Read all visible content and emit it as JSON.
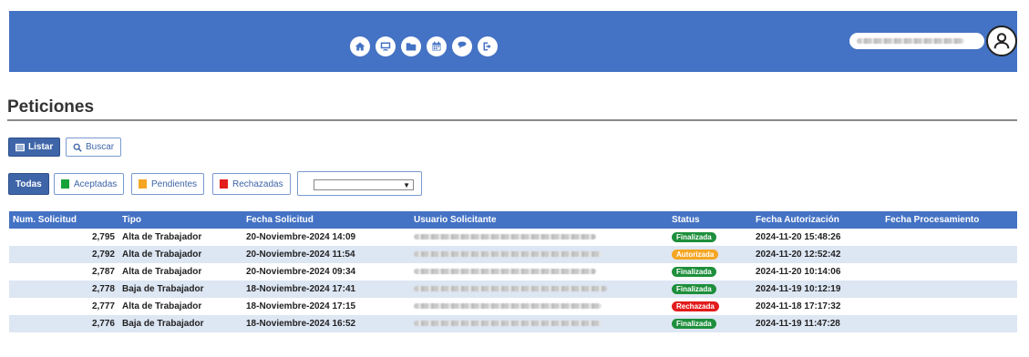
{
  "header": {
    "nav_icons": [
      "home-icon",
      "monitor-icon",
      "folder-icon",
      "calendar-icon",
      "chat-icon",
      "logout-icon"
    ],
    "user_name": "",
    "user_icon": "user-icon"
  },
  "page": {
    "title": "Peticiones"
  },
  "toolbar": {
    "list_label": "Listar",
    "search_label": "Buscar"
  },
  "filters": {
    "all_label": "Todas",
    "accepted_label": "Aceptadas",
    "pending_label": "Pendientes",
    "rejected_label": "Rechazadas",
    "accepted_color": "#17a33a",
    "pending_color": "#f5a623",
    "rejected_color": "#e31c1c",
    "select_value": ""
  },
  "table": {
    "columns": [
      "Num. Solicitud",
      "Tipo",
      "Fecha Solicitud",
      "Usuario Solicitante",
      "Status",
      "Fecha Autorización",
      "Fecha Procesamiento"
    ],
    "rows": [
      {
        "num": "2,795",
        "tipo": "Alta de Trabajador",
        "fecha_solicitud": "20-Noviembre-2024  14:09",
        "usuario": "",
        "status": "Finalizada",
        "status_color": "#1e8f3c",
        "fecha_autorizacion": "2024-11-20 15:48:26",
        "fecha_procesamiento": ""
      },
      {
        "num": "2,792",
        "tipo": "Alta de Trabajador",
        "fecha_solicitud": "20-Noviembre-2024  11:54",
        "usuario": "",
        "status": "Autorizada",
        "status_color": "#f5a623",
        "fecha_autorizacion": "2024-11-20 12:52:42",
        "fecha_procesamiento": ""
      },
      {
        "num": "2,787",
        "tipo": "Alta de Trabajador",
        "fecha_solicitud": "20-Noviembre-2024  09:34",
        "usuario": "",
        "status": "Finalizada",
        "status_color": "#1e8f3c",
        "fecha_autorizacion": "2024-11-20 10:14:06",
        "fecha_procesamiento": ""
      },
      {
        "num": "2,778",
        "tipo": "Baja de Trabajador",
        "fecha_solicitud": "18-Noviembre-2024  17:41",
        "usuario": "",
        "status": "Finalizada",
        "status_color": "#1e8f3c",
        "fecha_autorizacion": "2024-11-19 10:12:19",
        "fecha_procesamiento": ""
      },
      {
        "num": "2,777",
        "tipo": "Alta de Trabajador",
        "fecha_solicitud": "18-Noviembre-2024  17:15",
        "usuario": "",
        "status": "Rechazada",
        "status_color": "#e31c1c",
        "fecha_autorizacion": "2024-11-18 17:17:32",
        "fecha_procesamiento": ""
      },
      {
        "num": "2,776",
        "tipo": "Baja de Trabajador",
        "fecha_solicitud": "18-Noviembre-2024  16:52",
        "usuario": "",
        "status": "Finalizada",
        "status_color": "#1e8f3c",
        "fecha_autorizacion": "2024-11-19 11:47:28",
        "fecha_procesamiento": ""
      }
    ]
  },
  "colors": {
    "header_bg": "#4472c4",
    "primary": "#3e65a8"
  }
}
